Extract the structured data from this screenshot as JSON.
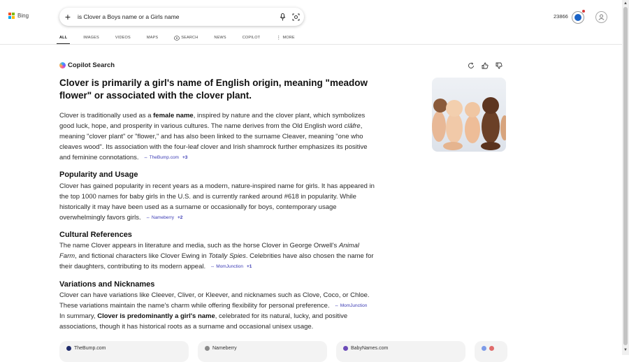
{
  "brand": {
    "name": "Bing"
  },
  "search": {
    "query": "is Clover a Boys name or a Girls name"
  },
  "header": {
    "points": "23866"
  },
  "tabs": [
    {
      "label": "ALL",
      "active": true
    },
    {
      "label": "IMAGES"
    },
    {
      "label": "VIDEOS"
    },
    {
      "label": "MAPS"
    },
    {
      "label": "SEARCH",
      "icon": "copilot-search-icon"
    },
    {
      "label": "NEWS"
    },
    {
      "label": "COPILOT"
    },
    {
      "label": "MORE",
      "icon": "more-vertical-icon"
    }
  ],
  "copilot": {
    "label": "Copilot Search",
    "heading": "Clover is primarily a girl's name of English origin, meaning \"meadow flower\" or associated with the clover plant.",
    "intro": {
      "t1": "Clover is traditionally used as a ",
      "b1": "female name",
      "t2": ", inspired by nature and the clover plant, which symbolizes good luck, hope, and prosperity in various cultures. The name derives from the Old English word ",
      "i1": "clāfre",
      "t3": ", meaning \"clover plant\" or \"flower,\" and has also been linked to the surname Cleaver, meaning \"one who cleaves wood\". Its association with the four-leaf clover and Irish shamrock further emphasizes its positive and feminine connotations.",
      "cite": "TheBump.com",
      "cite_more": "+3"
    },
    "popularity": {
      "title": "Popularity and Usage",
      "text": "Clover has gained popularity in recent years as a modern, nature-inspired name for girls. It has appeared in the top 1000 names for baby girls in the U.S. and is currently ranked around #618 in popularity. While historically it may have been used as a surname or occasionally for boys, contemporary usage overwhelmingly favors girls.",
      "cite": "Nameberry",
      "cite_more": "+2"
    },
    "cultural": {
      "title": "Cultural References",
      "t1": "The name Clover appears in literature and media, such as the horse Clover in George Orwell's ",
      "i1": "Animal Farm",
      "t2": ", and fictional characters like Clover Ewing in ",
      "i2": "Totally Spies",
      "t3": ". Celebrities have also chosen the name for their daughters, contributing to its modern appeal.",
      "cite": "MomJunction",
      "cite_more": "+1"
    },
    "variations": {
      "title": "Variations and Nicknames",
      "text": "Clover can have variations like Cleever, Cliver, or Kleever, and nicknames such as Clove, Coco, or Chloe. These variations maintain the name's charm while offering flexibility for personal preference.",
      "cite": "MomJunction"
    },
    "summary": {
      "t1": "In summary, ",
      "b1": "Clover is predominantly a girl's name",
      "t2": ", celebrated for its natural, lucky, and positive associations, though it has historical roots as a surname and occasional unisex usage."
    }
  },
  "sources": [
    {
      "label": "TheBump.com",
      "color": "#1f2b6b"
    },
    {
      "label": "Nameberry",
      "color": "#8a8a8a"
    },
    {
      "label": "BabyNames.com",
      "color": "#6b4bb8"
    }
  ],
  "colors": {
    "accent": "#1b64c7",
    "citation": "#3b3bb4"
  }
}
